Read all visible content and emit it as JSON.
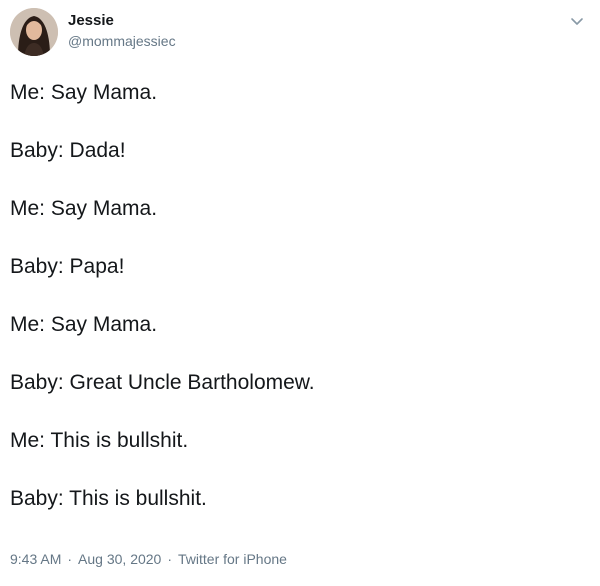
{
  "user": {
    "display_name": "Jessie",
    "handle": "@mommajessiec"
  },
  "tweet": {
    "lines": [
      "Me: Say Mama.",
      "Baby: Dada!",
      "Me: Say Mama.",
      "Baby: Papa!",
      "Me: Say Mama.",
      "Baby: Great Uncle Bartholomew.",
      "Me: This is bullshit.",
      "Baby: This is bullshit."
    ]
  },
  "meta": {
    "time": "9:43 AM",
    "date": "Aug 30, 2020",
    "source": "Twitter for iPhone",
    "separator": "·"
  },
  "icons": {
    "avatar": "profile-photo",
    "menu": "chevron-down-icon"
  },
  "colors": {
    "text": "#14171a",
    "secondary_text": "#657786"
  }
}
